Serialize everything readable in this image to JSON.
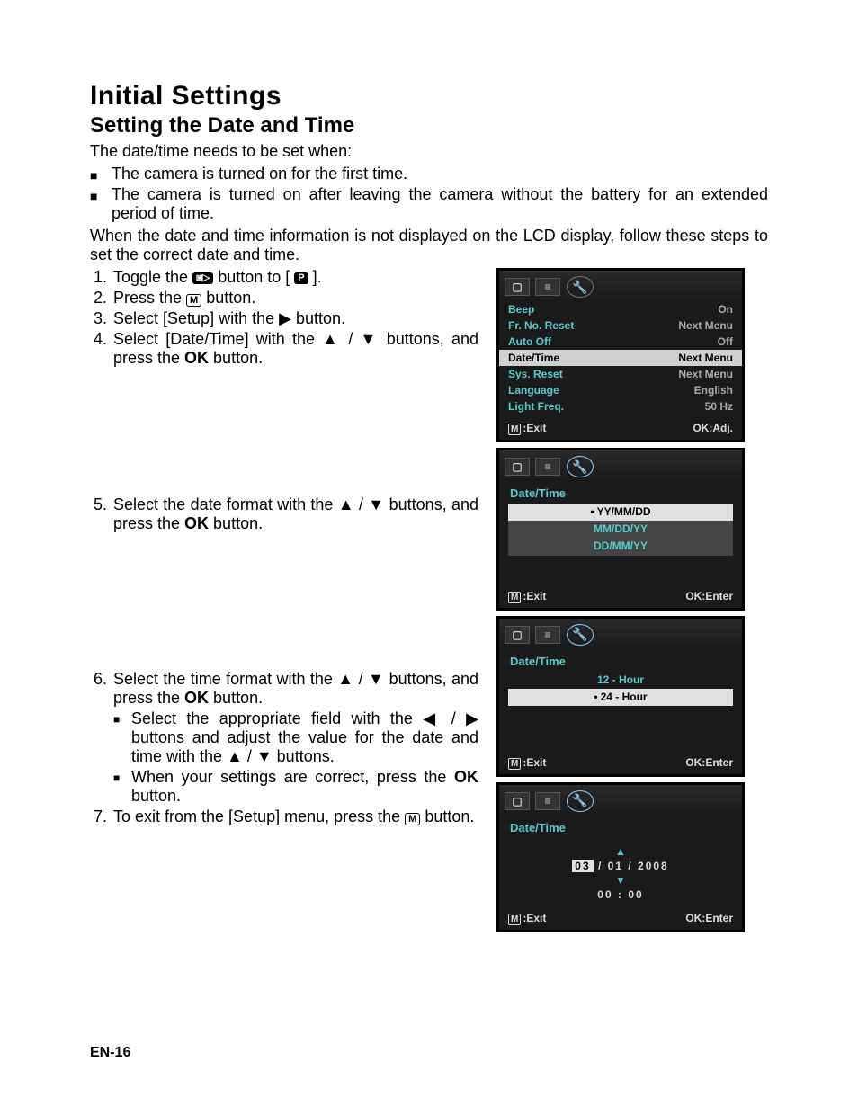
{
  "heading": "Initial Settings",
  "subheading": "Setting the Date and Time",
  "intro": "The date/time needs to be set when:",
  "bullets": [
    "The camera is turned on for the first time.",
    "The camera is turned on after leaving the camera without the battery for an extended period of time."
  ],
  "para2": "When the date and time information is not displayed on the LCD display, follow these steps to set the correct date and time.",
  "steps": {
    "s1a": "Toggle the ",
    "s1b": " button to [ ",
    "s1c": " ].",
    "s2a": "Press the ",
    "s2b": " button.",
    "s3": "Select [Setup] with the ▶ button.",
    "s4a": "Select [Date/Time] with the ▲ / ▼ buttons, and press the ",
    "s4ok": "OK",
    "s4b": " button.",
    "s5a": "Select the date format with the ▲ / ▼ buttons, and press the ",
    "s5ok": "OK",
    "s5b": " button.",
    "s6a": "Select the time format with the ▲ / ▼ buttons, and press the ",
    "s6ok": "OK",
    "s6b": " button.",
    "s6_b1a": "Select the appropriate field with the ◀ / ▶ buttons and adjust the value for the date and time with the ▲ / ▼ buttons.",
    "s6_b2a": "When your settings are correct, press the ",
    "s6_b2ok": "OK",
    "s6_b2b": " button.",
    "s7a": "To exit from the [Setup] menu, press the ",
    "s7b": " button."
  },
  "iconM": "M",
  "iconP": "P",
  "iconCamPlay": "◙▷",
  "lcd1": {
    "rows": [
      {
        "label": "Beep",
        "val": "On",
        "sel": false
      },
      {
        "label": "Fr. No. Reset",
        "val": "Next Menu",
        "sel": false
      },
      {
        "label": "Auto Off",
        "val": "Off",
        "sel": false
      },
      {
        "label": "Date/Time",
        "val": "Next Menu",
        "sel": true
      },
      {
        "label": "Sys. Reset",
        "val": "Next Menu",
        "sel": false
      },
      {
        "label": "Language",
        "val": "English",
        "sel": false
      },
      {
        "label": "Light Freq.",
        "val": "50 Hz",
        "sel": false
      }
    ],
    "footL": ":Exit",
    "footR": "OK:Adj."
  },
  "lcd2": {
    "title": "Date/Time",
    "items": [
      "YY/MM/DD",
      "MM/DD/YY",
      "DD/MM/YY"
    ],
    "footL": ":Exit",
    "footR": "OK:Enter"
  },
  "lcd3": {
    "title": "Date/Time",
    "items": [
      "12 - Hour",
      "24 - Hour"
    ],
    "selIndex": 1,
    "footL": ":Exit",
    "footR": "OK:Enter"
  },
  "lcd4": {
    "title": "Date/Time",
    "mm": "03",
    "dd": "01",
    "yy": "2008",
    "hh": "00",
    "min": "00",
    "footL": ":Exit",
    "footR": "OK:Enter"
  },
  "pageNum": "EN-16"
}
